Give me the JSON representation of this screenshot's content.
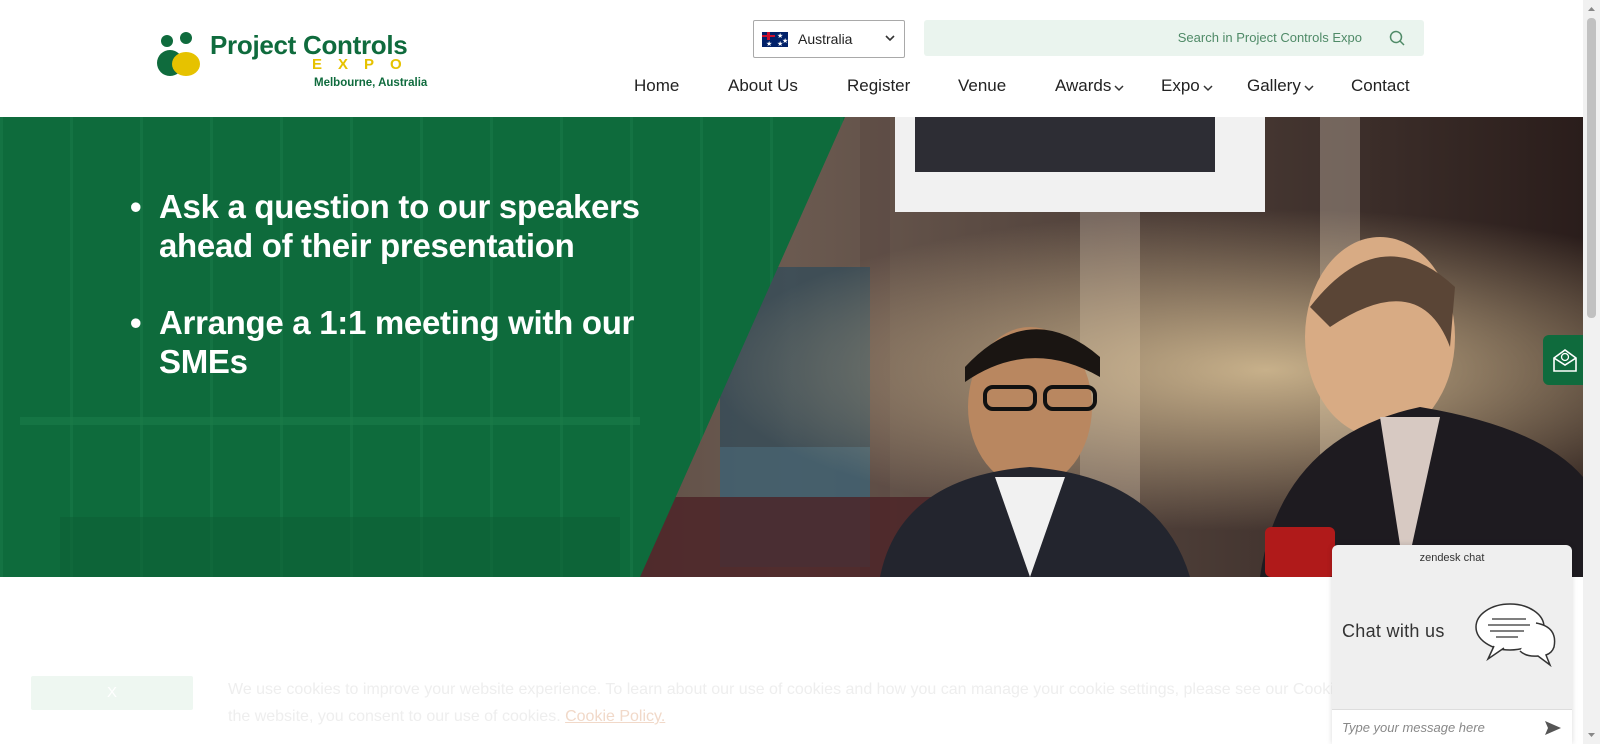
{
  "logo": {
    "name": "Project Controls",
    "expo": "EXPO",
    "location": "Melbourne, Australia"
  },
  "country_select": {
    "value": "Australia",
    "flag_icon": "australia-flag-icon"
  },
  "search": {
    "placeholder": "Search in Project Controls Expo",
    "icon": "search-icon"
  },
  "nav": {
    "items": [
      {
        "label": "Home",
        "has_dropdown": false
      },
      {
        "label": "About Us",
        "has_dropdown": false
      },
      {
        "label": "Register",
        "has_dropdown": false
      },
      {
        "label": "Venue",
        "has_dropdown": false
      },
      {
        "label": "Awards",
        "has_dropdown": true
      },
      {
        "label": "Expo",
        "has_dropdown": true
      },
      {
        "label": "Gallery",
        "has_dropdown": true
      },
      {
        "label": "Contact",
        "has_dropdown": false
      }
    ]
  },
  "hero": {
    "bullets": [
      "Ask a question to our speakers ahead of their presentation",
      "Arrange a 1:1 meeting with our SMEs"
    ]
  },
  "cookie": {
    "close_label": "X",
    "line1": "We use cookies to improve your website experience. To learn about our use of cookies and how you can manage your cookie settings, please see our Cookie",
    "line2_prefix": "the website, you consent to our use of cookies.",
    "link": "Cookie Policy."
  },
  "zendesk": {
    "brand": "zendesk chat",
    "title": "Chat with us",
    "input_placeholder": "Type your message here"
  },
  "colors": {
    "brand_green": "#0f6b3d",
    "brand_yellow": "#e6c200",
    "search_bg": "#eaf4ee"
  }
}
